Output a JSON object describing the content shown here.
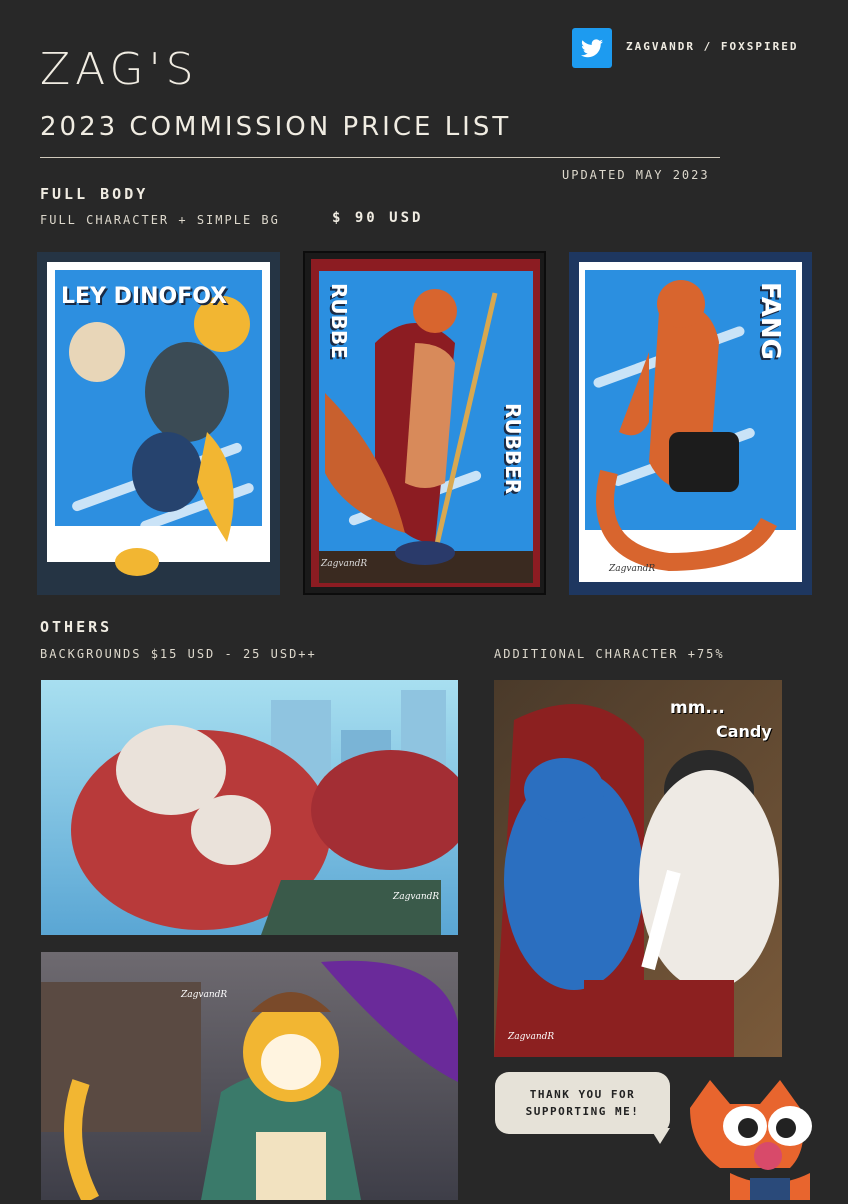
{
  "header": {
    "title": "ZAG'S",
    "subtitle": "2023 COMMISSION PRICE LIST",
    "social_handle": "ZAGVANDR / FOXSPIRED",
    "social_icon": "twitter-bird-icon",
    "updated": "UPDATED MAY 2023"
  },
  "full_body": {
    "heading": "FULL BODY",
    "description": "FULL CHARACTER + SIMPLE BG",
    "price": "$ 90 USD",
    "examples": [
      {
        "label": "LEY DINOFOX"
      },
      {
        "label_top": "RUBBE",
        "label_bottom": "RUBBER",
        "signature": "ZagvandR"
      },
      {
        "label": "FANG",
        "signature": "ZagvandR"
      }
    ]
  },
  "others": {
    "heading": "OTHERS",
    "backgrounds": "BACKGROUNDS $15 USD - 25 USD++",
    "additional": "ADDITIONAL CHARACTER +75%",
    "bg_example_1_signature": "ZagvandR",
    "bg_example_2_signature": "ZagvandR",
    "duo_text_1": "mm...",
    "duo_text_2": "Candy",
    "duo_signature": "ZagvandR"
  },
  "footer": {
    "message": "THANK YOU FOR SUPPORTING ME!"
  },
  "colors": {
    "background": "#282828",
    "text": "#ece8dc",
    "twitter": "#1d9bf0"
  }
}
